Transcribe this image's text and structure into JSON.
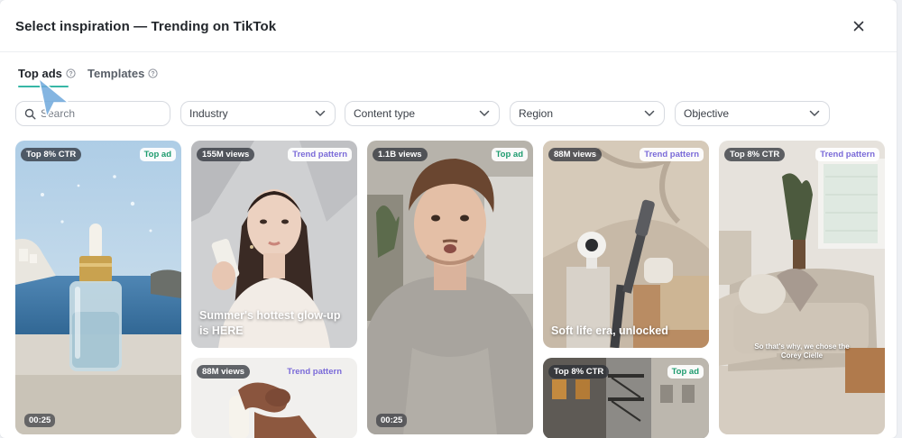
{
  "header": {
    "title": "Select inspiration — Trending on TikTok"
  },
  "tabs": [
    {
      "label": "Top ads"
    },
    {
      "label": "Templates"
    }
  ],
  "filters": {
    "search_placeholder": "Search",
    "dropdowns": [
      {
        "label": "Industry"
      },
      {
        "label": "Content type"
      },
      {
        "label": "Region"
      },
      {
        "label": "Objective"
      }
    ]
  },
  "cards": [
    {
      "metric": "Top 8% CTR",
      "tag": "Top ad",
      "duration": "00:25"
    },
    {
      "metric": "155M views",
      "tag": "Trend pattern",
      "caption": "Summer's hottest glow-up is HERE"
    },
    {
      "metric": "88M views",
      "tag": "Trend pattern"
    },
    {
      "metric": "1.1B views",
      "tag": "Top ad",
      "duration": "00:25"
    },
    {
      "metric": "88M views",
      "tag": "Trend pattern",
      "caption": "Soft life era, unlocked"
    },
    {
      "metric": "Top 8% CTR",
      "tag": "Top ad"
    },
    {
      "metric": "Top 8% CTR",
      "tag": "Trend pattern",
      "subtitle": "So that's why, we chose the Corey Cielle"
    }
  ],
  "colors": {
    "accent": "#37b7a6",
    "top_ad": "#1d9b6e",
    "trend": "#7a6ad8"
  }
}
